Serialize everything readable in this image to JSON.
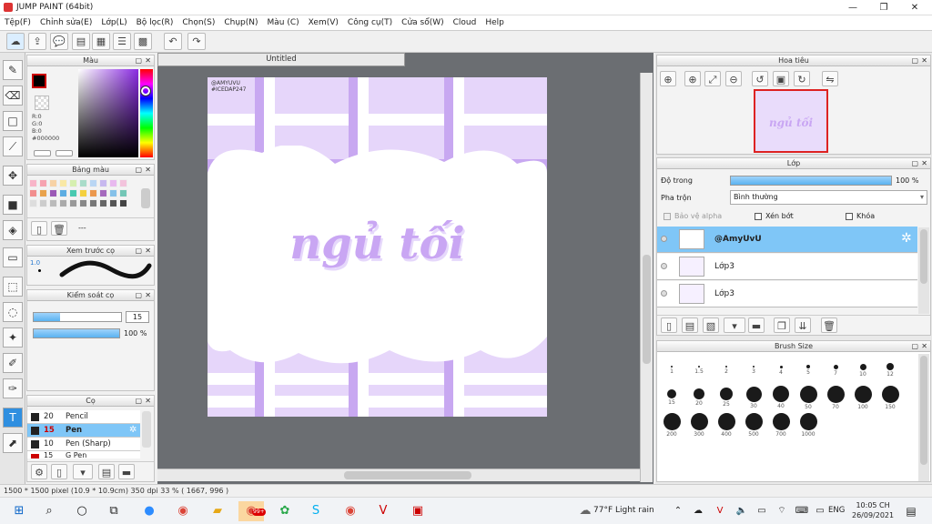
{
  "window": {
    "title": "JUMP PAINT (64bit)"
  },
  "menu": [
    "Tệp(F)",
    "Chỉnh sửa(E)",
    "Lớp(L)",
    "Bộ lọc(R)",
    "Chọn(S)",
    "Chụp(N)",
    "Màu (C)",
    "Xem(V)",
    "Công cụ(T)",
    "Cửa sổ(W)",
    "Cloud",
    "Help"
  ],
  "panels": {
    "color": {
      "title": "Màu",
      "r": "R:0",
      "g": "G:0",
      "b": "B:0",
      "hex": "#000000",
      "fg_color": "#000000"
    },
    "palette": {
      "title": "Bảng màu",
      "dash": "---"
    },
    "preview": {
      "title": "Xem trước cọ",
      "size": "1.0"
    },
    "brush_control": {
      "title": "Kiểm soát cọ",
      "size_value": "15",
      "opacity_value": "100 %"
    },
    "brushes": {
      "title": "Cọ",
      "items": [
        {
          "size": "20",
          "name": "Pencil"
        },
        {
          "size": "15",
          "name": "Pen"
        },
        {
          "size": "10",
          "name": "Pen (Sharp)"
        },
        {
          "size": "15",
          "name": "G Pen"
        }
      ]
    }
  },
  "document": {
    "tab_title": "Untitled",
    "canvas_text": "ngủ tối",
    "watermark_line1": "@AMYUVU",
    "watermark_line2": "#ICEDAP247"
  },
  "navigator": {
    "title": "Hoa tiêu",
    "thumb_text": "ngủ tối"
  },
  "layer_panel": {
    "title": "Lớp",
    "opacity_label": "Độ trong",
    "opacity_value": "100 %",
    "opacity_fraction": 1.0,
    "blend_label": "Pha trộn",
    "blend_value": "Bình thường",
    "protect_alpha": "Bảo vệ alpha",
    "clipping": "Xén bớt",
    "lock": "Khóa",
    "layers": [
      "@AmyUvU",
      "Lớp3",
      "Lớp3"
    ]
  },
  "brush_size": {
    "title": "Brush Size",
    "sizes": [
      "1",
      "1.5",
      "2",
      "3",
      "4",
      "5",
      "7",
      "10",
      "12",
      "15",
      "20",
      "25",
      "30",
      "40",
      "50",
      "70",
      "100",
      "150",
      "200",
      "300",
      "400",
      "500",
      "700",
      "1000"
    ]
  },
  "status": {
    "text": "1500 * 1500 pixel   (10.9 * 10.9cm)  350 dpi   33 %   ( 1667, 996 )"
  },
  "taskbar": {
    "weather": "77°F  Light rain",
    "lang": "ENG",
    "time": "10:05 CH",
    "date": "26/09/2021",
    "badge": "99+"
  }
}
